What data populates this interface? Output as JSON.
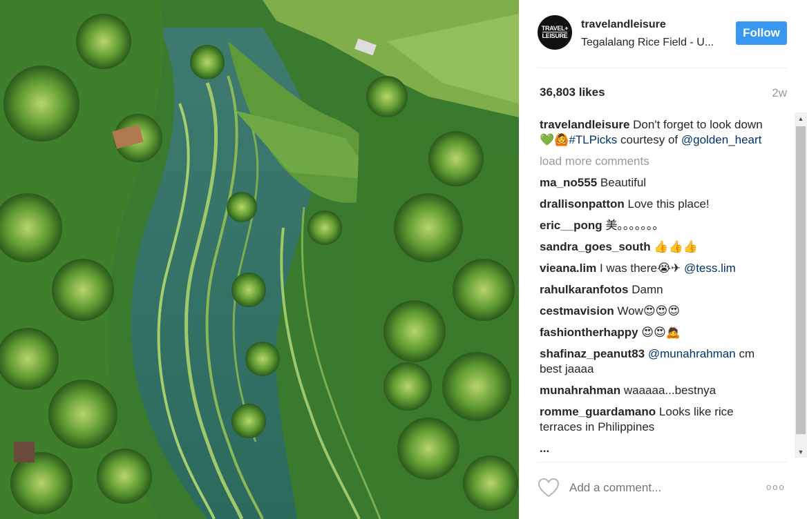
{
  "post": {
    "avatar_text_1": "TRAVEL+",
    "avatar_text_2": "LEISURE",
    "username": "travelandleisure",
    "location": "Tegalalang Rice Field - U...",
    "follow_label": "Follow",
    "likes": "36,803 likes",
    "time": "2w"
  },
  "caption": {
    "user": "travelandleisure",
    "text_1": "Don't forget to look down",
    "emoji_1": "💚",
    "emoji_2": "🙆",
    "hashtag": "#TLPicks",
    "text_2": "courtesy of",
    "mention": "@golden_heart"
  },
  "load_more": "load more comments",
  "comments": [
    {
      "user": "ma_no555",
      "text": "Beautiful"
    },
    {
      "user": "drallisonpatton",
      "text": "Love this place!"
    },
    {
      "user": "eric__pong",
      "text": "美。。。。。。。"
    },
    {
      "user": "sandra_goes_south",
      "text": "👍👍👍"
    },
    {
      "user": "vieana.lim",
      "text": "I was there😭✈",
      "mention": "@tess.lim"
    },
    {
      "user": "rahulkaranfotos",
      "text": "Damn"
    },
    {
      "user": "cestmavision",
      "text": "Wow😍😍😍"
    },
    {
      "user": "fashiontherhappy",
      "text": "😍😍🙇"
    },
    {
      "user": "shafinaz_peanut83",
      "mention": "@munahrahman",
      "text": "cm best jaaaa"
    },
    {
      "user": "munahrahman",
      "text": "waaaaa...bestnya"
    },
    {
      "user": "romme_guardamano",
      "text": "Looks like rice terraces in Philippines"
    },
    {
      "user": "...",
      "text": ""
    }
  ],
  "add_comment_placeholder": "Add a comment...",
  "more_options": "ooo",
  "icons": {
    "heart": "heart-icon",
    "more": "more-options-icon",
    "scroll_up": "scroll-up-arrow-icon",
    "scroll_down": "scroll-down-arrow-icon"
  },
  "colors": {
    "follow_button": "#3897f0",
    "link": "#003569",
    "muted": "#999999"
  }
}
